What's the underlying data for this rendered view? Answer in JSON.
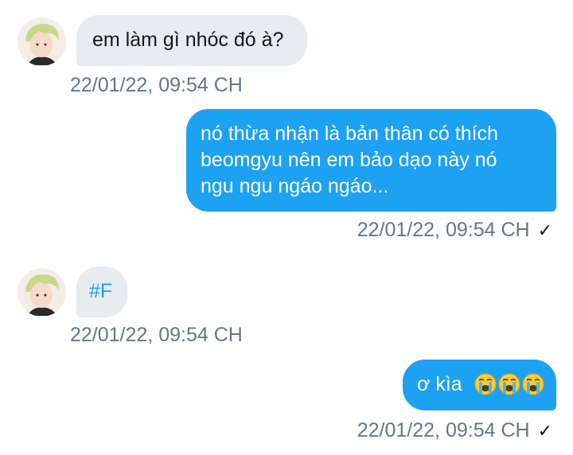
{
  "conversation": {
    "messages": [
      {
        "side": "in",
        "text": "em làm gì nhóc đó à?",
        "timestamp": "22/01/22, 09:54 CH"
      },
      {
        "side": "out",
        "lines": [
          "nó thừa nhận là bản thân có thích",
          "beomgyu nên em bảo dạo này nó",
          "ngu ngu ngáo ngáo..."
        ],
        "timestamp": "22/01/22, 09:54 CH",
        "read_receipt": "✓"
      },
      {
        "side": "in",
        "text": "#F",
        "timestamp": "22/01/22, 09:54 CH"
      },
      {
        "side": "out",
        "text": "ơ kìa",
        "emojis": [
          "loudly-crying-face-icon",
          "loudly-crying-face-icon",
          "loudly-crying-face-icon"
        ],
        "timestamp": "22/01/22, 09:54 CH",
        "read_receipt": "✓"
      }
    ]
  },
  "colors": {
    "incoming_bubble": "#e6ecf0",
    "outgoing_bubble": "#1da1f2",
    "hashtag": "#1da1f2",
    "timestamp": "#657786"
  }
}
